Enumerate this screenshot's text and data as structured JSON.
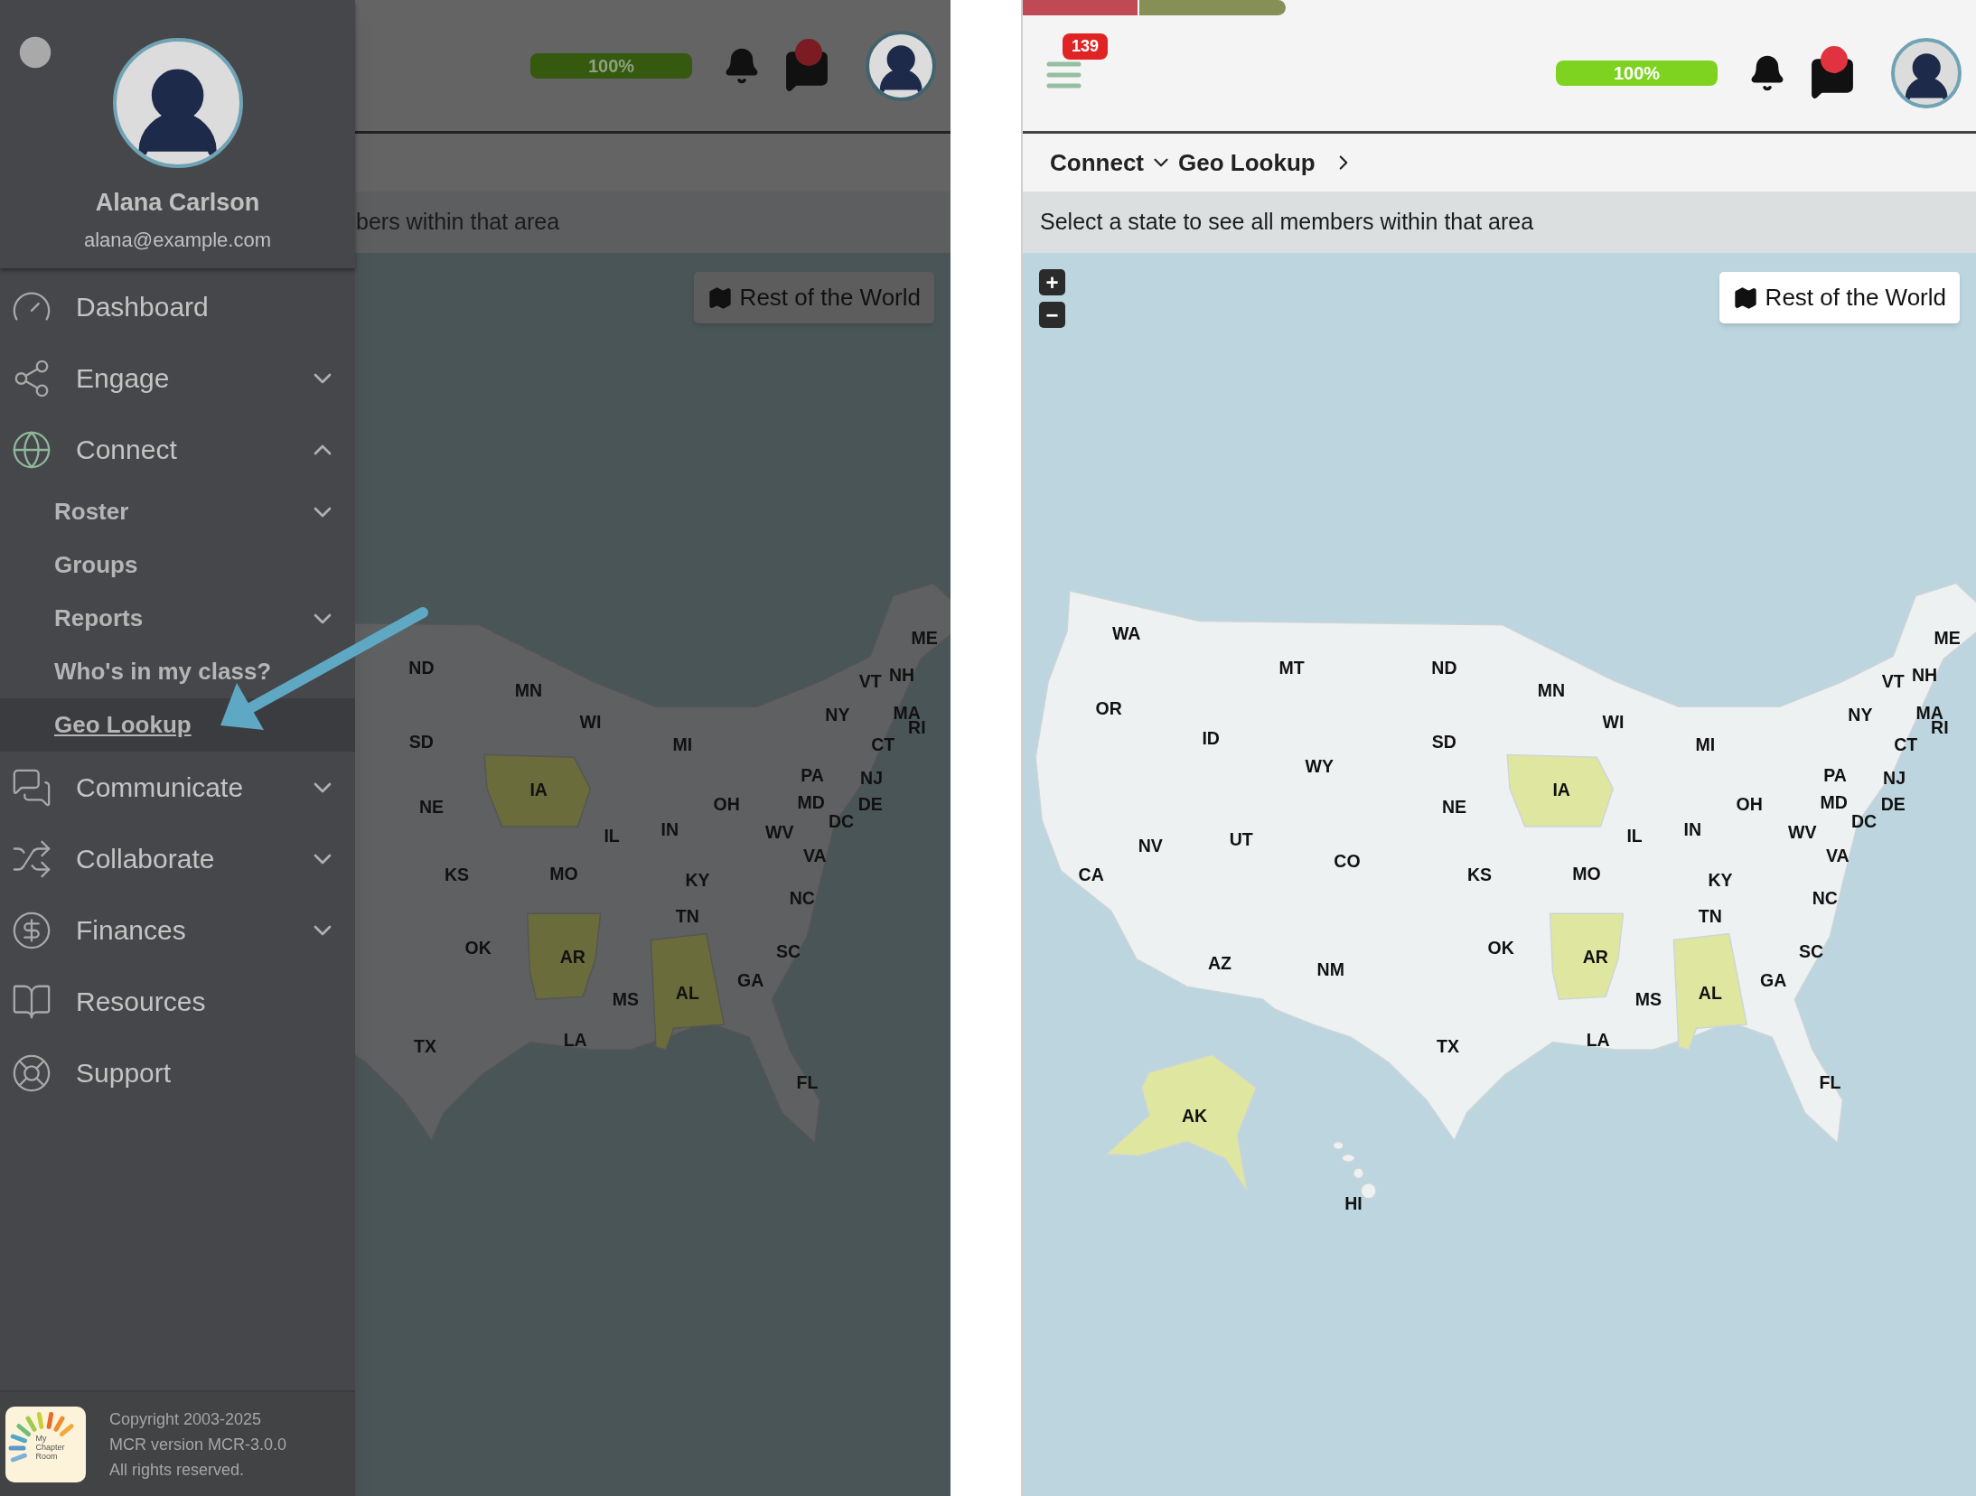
{
  "left_panel": {
    "header": {
      "progress": {
        "level": 1,
        "reading": "100%"
      }
    },
    "subtitle": "bers within that area",
    "map_button": "Rest of the World",
    "map_states": [
      {
        "label": "ME",
        "highlighted": false
      },
      {
        "label": "ND",
        "highlighted": false
      },
      {
        "label": "VT",
        "highlighted": false
      },
      {
        "label": "NH",
        "highlighted": false
      },
      {
        "label": "MN",
        "highlighted": false
      },
      {
        "label": "NY",
        "highlighted": false
      },
      {
        "label": "MA",
        "highlighted": false
      },
      {
        "label": "WI",
        "highlighted": false
      },
      {
        "label": "RI",
        "highlighted": false
      },
      {
        "label": "SD",
        "highlighted": false
      },
      {
        "label": "MI",
        "highlighted": false
      },
      {
        "label": "CT",
        "highlighted": false
      },
      {
        "label": "PA",
        "highlighted": false
      },
      {
        "label": "NJ",
        "highlighted": false
      },
      {
        "label": "IA",
        "highlighted": true
      },
      {
        "label": "NE",
        "highlighted": false
      },
      {
        "label": "OH",
        "highlighted": false
      },
      {
        "label": "MD",
        "highlighted": false
      },
      {
        "label": "DE",
        "highlighted": false
      },
      {
        "label": "IL",
        "highlighted": false
      },
      {
        "label": "IN",
        "highlighted": false
      },
      {
        "label": "WV",
        "highlighted": false
      },
      {
        "label": "DC",
        "highlighted": false
      },
      {
        "label": "KS",
        "highlighted": false
      },
      {
        "label": "MO",
        "highlighted": false
      },
      {
        "label": "KY",
        "highlighted": false
      },
      {
        "label": "VA",
        "highlighted": false
      },
      {
        "label": "TN",
        "highlighted": false
      },
      {
        "label": "NC",
        "highlighted": false
      },
      {
        "label": "OK",
        "highlighted": false
      },
      {
        "label": "AR",
        "highlighted": true
      },
      {
        "label": "SC",
        "highlighted": false
      },
      {
        "label": "MS",
        "highlighted": false
      },
      {
        "label": "AL",
        "highlighted": true
      },
      {
        "label": "GA",
        "highlighted": false
      },
      {
        "label": "TX",
        "highlighted": false
      },
      {
        "label": "LA",
        "highlighted": false
      },
      {
        "label": "FL",
        "highlighted": false
      }
    ],
    "sidebar": {
      "user": {
        "name": "Alana Carlson",
        "email": "alana@example.com"
      },
      "nav": [
        {
          "label": "Dashboard",
          "kind": "link",
          "selected": false
        },
        {
          "label": "Engage",
          "kind": "group",
          "expanded": false,
          "selected": false
        },
        {
          "label": "Connect",
          "kind": "group",
          "expanded": true,
          "selected": false,
          "children": [
            {
              "label": "Roster",
              "kind": "group",
              "expanded": false,
              "selected": false
            },
            {
              "label": "Groups",
              "kind": "link",
              "selected": false
            },
            {
              "label": "Reports",
              "kind": "group",
              "expanded": false,
              "selected": false
            },
            {
              "label": "Who's in my class?",
              "kind": "link",
              "selected": false
            },
            {
              "label": "Geo Lookup",
              "kind": "link",
              "selected": true
            }
          ]
        },
        {
          "label": "Communicate",
          "kind": "group",
          "expanded": false,
          "selected": false
        },
        {
          "label": "Collaborate",
          "kind": "group",
          "expanded": false,
          "selected": false
        },
        {
          "label": "Finances",
          "kind": "group",
          "expanded": false,
          "selected": false
        },
        {
          "label": "Resources",
          "kind": "link",
          "selected": false
        },
        {
          "label": "Support",
          "kind": "link",
          "selected": false
        }
      ],
      "footer": {
        "logo_lines": [
          "My",
          "Chapter",
          "Room"
        ],
        "lines": [
          "Copyright 2003-2025",
          "MCR version MCR-3.0.0",
          "All rights reserved."
        ]
      }
    }
  },
  "right_panel": {
    "header": {
      "menu_badge": "139",
      "progress": {
        "level": 1,
        "reading": "100%"
      }
    },
    "breadcrumb": [
      {
        "label": "Connect",
        "kind": "dropdown"
      },
      {
        "label": "Geo Lookup",
        "kind": "next"
      }
    ],
    "subtitle": "Select a state to see all members within that area",
    "zoom_controls": [
      "+",
      "−"
    ],
    "map_button": "Rest of the World",
    "map_states": [
      {
        "label": "WA",
        "highlighted": false
      },
      {
        "label": "ME",
        "highlighted": false
      },
      {
        "label": "MT",
        "highlighted": false
      },
      {
        "label": "ND",
        "highlighted": false
      },
      {
        "label": "VT",
        "highlighted": false
      },
      {
        "label": "NH",
        "highlighted": false
      },
      {
        "label": "MN",
        "highlighted": false
      },
      {
        "label": "OR",
        "highlighted": false
      },
      {
        "label": "NY",
        "highlighted": false
      },
      {
        "label": "MA",
        "highlighted": false
      },
      {
        "label": "WI",
        "highlighted": false
      },
      {
        "label": "RI",
        "highlighted": false
      },
      {
        "label": "ID",
        "highlighted": false
      },
      {
        "label": "SD",
        "highlighted": false
      },
      {
        "label": "MI",
        "highlighted": false
      },
      {
        "label": "CT",
        "highlighted": false
      },
      {
        "label": "WY",
        "highlighted": false
      },
      {
        "label": "PA",
        "highlighted": false
      },
      {
        "label": "NJ",
        "highlighted": false
      },
      {
        "label": "IA",
        "highlighted": true
      },
      {
        "label": "NE",
        "highlighted": false
      },
      {
        "label": "OH",
        "highlighted": false
      },
      {
        "label": "MD",
        "highlighted": false
      },
      {
        "label": "DE",
        "highlighted": false
      },
      {
        "label": "NV",
        "highlighted": false
      },
      {
        "label": "UT",
        "highlighted": false
      },
      {
        "label": "IL",
        "highlighted": false
      },
      {
        "label": "IN",
        "highlighted": false
      },
      {
        "label": "WV",
        "highlighted": false
      },
      {
        "label": "DC",
        "highlighted": false
      },
      {
        "label": "CA",
        "highlighted": false
      },
      {
        "label": "CO",
        "highlighted": false
      },
      {
        "label": "KS",
        "highlighted": false
      },
      {
        "label": "MO",
        "highlighted": false
      },
      {
        "label": "KY",
        "highlighted": false
      },
      {
        "label": "VA",
        "highlighted": false
      },
      {
        "label": "TN",
        "highlighted": false
      },
      {
        "label": "NC",
        "highlighted": false
      },
      {
        "label": "AZ",
        "highlighted": false
      },
      {
        "label": "NM",
        "highlighted": false
      },
      {
        "label": "OK",
        "highlighted": false
      },
      {
        "label": "AR",
        "highlighted": true
      },
      {
        "label": "SC",
        "highlighted": false
      },
      {
        "label": "MS",
        "highlighted": false
      },
      {
        "label": "AL",
        "highlighted": true
      },
      {
        "label": "GA",
        "highlighted": false
      },
      {
        "label": "TX",
        "highlighted": false
      },
      {
        "label": "LA",
        "highlighted": false
      },
      {
        "label": "FL",
        "highlighted": false
      },
      {
        "label": "AK",
        "highlighted": true
      },
      {
        "label": "HI",
        "highlighted": false
      }
    ]
  }
}
